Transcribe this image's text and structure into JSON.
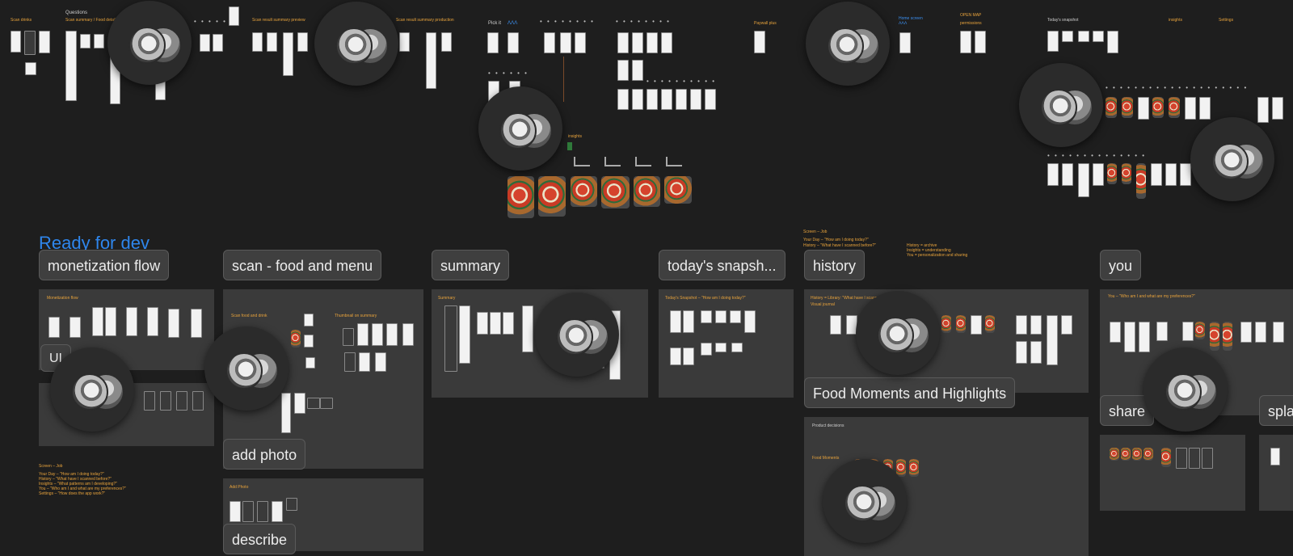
{
  "heading": "Ready for dev",
  "top_labels": {
    "questions": "Questions",
    "pick_it": "Pick it",
    "insights": "insights",
    "settings": "Settings"
  },
  "sections": [
    {
      "id": "monetization",
      "label": "monetization flow"
    },
    {
      "id": "scan",
      "label": "scan - food and menu"
    },
    {
      "id": "summary",
      "label": "summary"
    },
    {
      "id": "snapshot",
      "label": "today's snapsh..."
    },
    {
      "id": "history",
      "label": "history"
    },
    {
      "id": "you",
      "label": "you"
    }
  ],
  "sublabels": {
    "ui": "UI",
    "add_photo": "add photo",
    "describe": "describe",
    "food_moments": "Food Moments and Highlights",
    "share": "share",
    "splash": "spla"
  },
  "panel_titles": {
    "monetization_flow": "Monetization flow",
    "scan_food_and_drink": "Scan food and drink",
    "thumbnail_on_summary": "Thumbnail on summary",
    "summary": "Summary",
    "todays_snapshot": "Today's Snapshot – \"How am I doing today?\"",
    "history_library": "History = Library: \"What have I scanned before?\"",
    "visual_journal": "Visual journal",
    "product_decisions": "Product decisions",
    "food_moments_small": "Food Moments",
    "add_photo_small": "Add Photo",
    "you_title": "You – \"Who am I and what are my preferences?\""
  },
  "jobs_note": {
    "title": "Screen – Job",
    "lines": [
      "Your Day – \"How am I doing today?\"",
      "History – \"What have I scanned before?\"",
      "Insights – \"What patterns am I developing?\"",
      "You – \"Who am I and what are my preferences?\"",
      "Settings – \"How does the app work?\""
    ]
  },
  "history_note": {
    "title": "Screen – Job",
    "lines": [
      "Your Day – \"How am I doing today?\"",
      "History – \"What have I scanned before?\""
    ],
    "right": [
      "History = archive",
      "Insights = understanding",
      "You = personalization and sharing"
    ]
  },
  "colors": {
    "canvas": "#1e1e1e",
    "panel": "#3a3a3a",
    "heading_blue": "#2f86ec",
    "note_orange": "#e8a33c"
  }
}
